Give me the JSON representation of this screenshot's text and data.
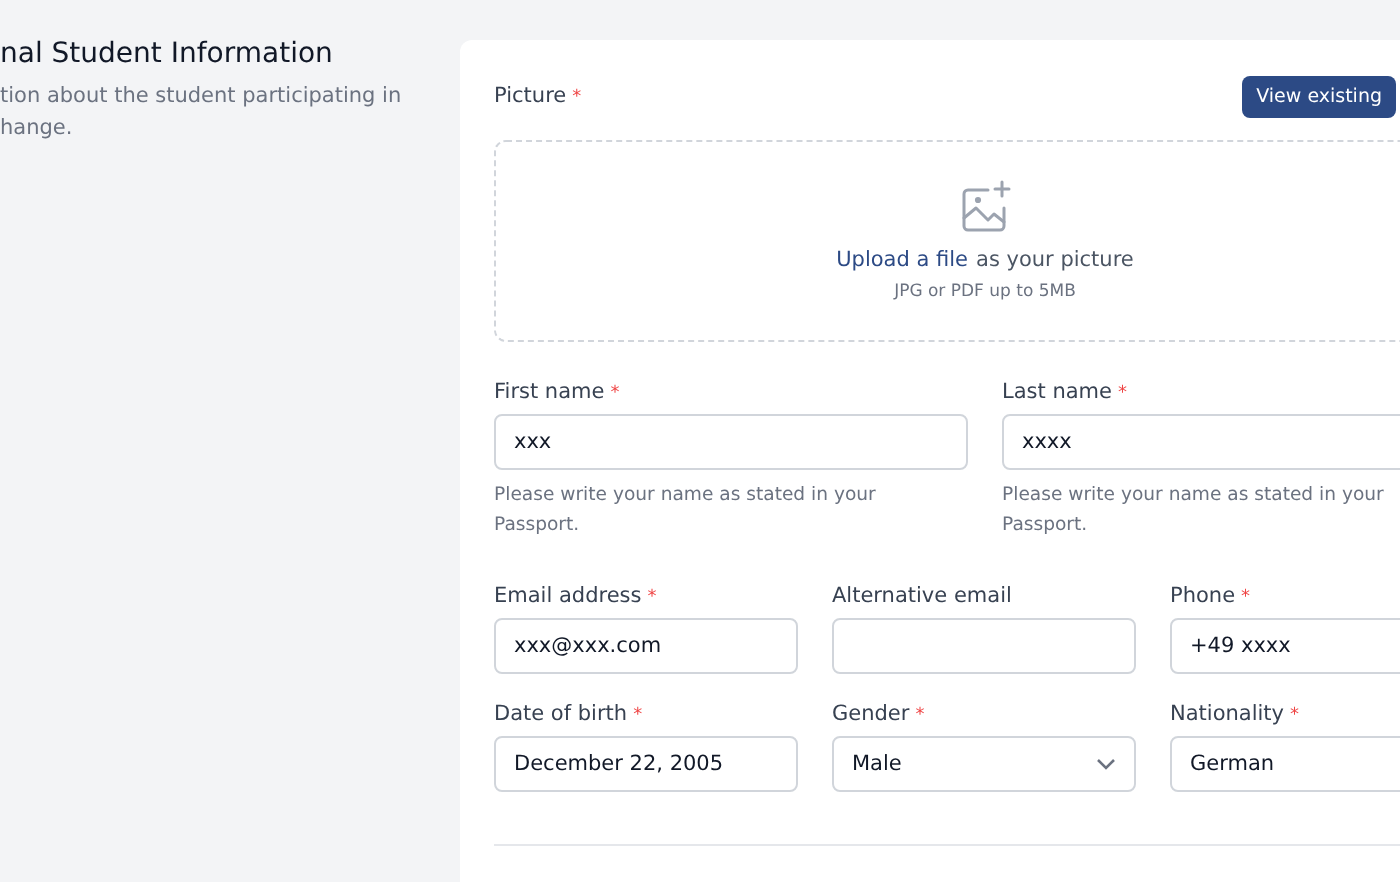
{
  "required_mark": "*",
  "section": {
    "title": "nal Student Information",
    "description": [
      "tion about the student participating in",
      "hange."
    ]
  },
  "picture": {
    "label": "Picture",
    "required": true,
    "button": "View existing",
    "upload": {
      "link": "Upload a file",
      "text": "as your picture",
      "hint": "JPG or PDF up to 5MB"
    }
  },
  "rows": [
    {
      "fields": [
        {
          "label": "First name",
          "required": true,
          "kind": "text",
          "value": "xxx",
          "helper": "Please write your name as stated in your Passport."
        },
        {
          "label": "Last name",
          "required": true,
          "kind": "text",
          "value": "xxxx",
          "helper": "Please write your name as stated in your Passport."
        }
      ]
    },
    {
      "fields": [
        {
          "label": "Email address",
          "required": true,
          "kind": "text",
          "value": "xxx@xxx.com"
        },
        {
          "label": "Alternative email",
          "required": false,
          "kind": "text"
        },
        {
          "label": "Phone",
          "required": true,
          "kind": "text",
          "value": "+49 xxxx"
        }
      ]
    },
    {
      "fields": [
        {
          "label": "Date of birth",
          "required": true,
          "kind": "text",
          "value": "December 22, 2005"
        },
        {
          "label": "Gender",
          "required": true,
          "kind": "select",
          "value": "Male"
        },
        {
          "label": "Nationality",
          "required": true,
          "kind": "text",
          "value": "German"
        }
      ]
    }
  ]
}
